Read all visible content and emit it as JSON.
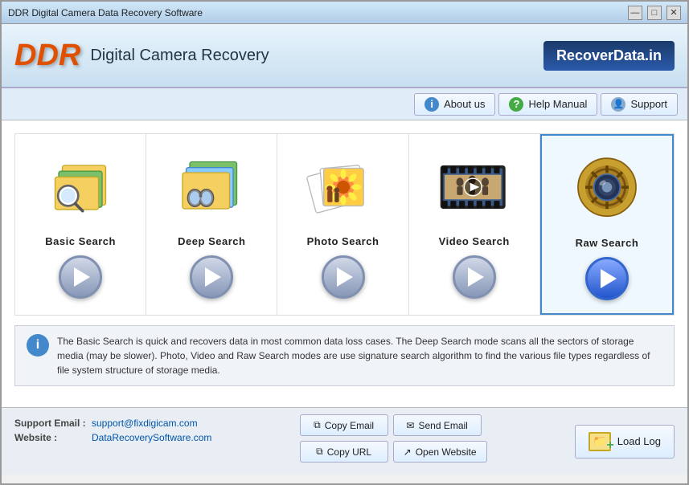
{
  "titlebar": {
    "title": "DDR Digital Camera Data Recovery Software",
    "min_label": "—",
    "max_label": "□",
    "close_label": "✕"
  },
  "header": {
    "logo": "DDR",
    "app_title": "Digital Camera Recovery",
    "brand": "RecoverData.in"
  },
  "nav": {
    "about_label": "About us",
    "help_label": "Help Manual",
    "support_label": "Support"
  },
  "search_items": [
    {
      "id": "basic",
      "label": "Basic  Search",
      "active": false
    },
    {
      "id": "deep",
      "label": "Deep  Search",
      "active": false
    },
    {
      "id": "photo",
      "label": "Photo  Search",
      "active": false
    },
    {
      "id": "video",
      "label": "Video  Search",
      "active": false
    },
    {
      "id": "raw",
      "label": "Raw  Search",
      "active": true
    }
  ],
  "info_text": "The Basic Search is quick and recovers data in most common data loss cases. The Deep Search mode scans all the sectors of storage media (may be slower). Photo, Video and Raw Search modes are use signature search algorithm to find the various file types regardless of file system structure of storage media.",
  "footer": {
    "support_label": "Support Email :",
    "support_email": "support@fixdigicam.com",
    "website_label": "Website :",
    "website_url": "DataRecoverySoftware.com",
    "copy_email_label": "Copy Email",
    "send_email_label": "Send Email",
    "copy_url_label": "Copy URL",
    "open_website_label": "Open Website",
    "load_log_label": "Load Log"
  },
  "icons": {
    "info_char": "i",
    "question_char": "?",
    "person_char": "👤",
    "copy_char": "⧉",
    "send_char": "✉",
    "url_char": "⧉",
    "web_char": "↗"
  }
}
